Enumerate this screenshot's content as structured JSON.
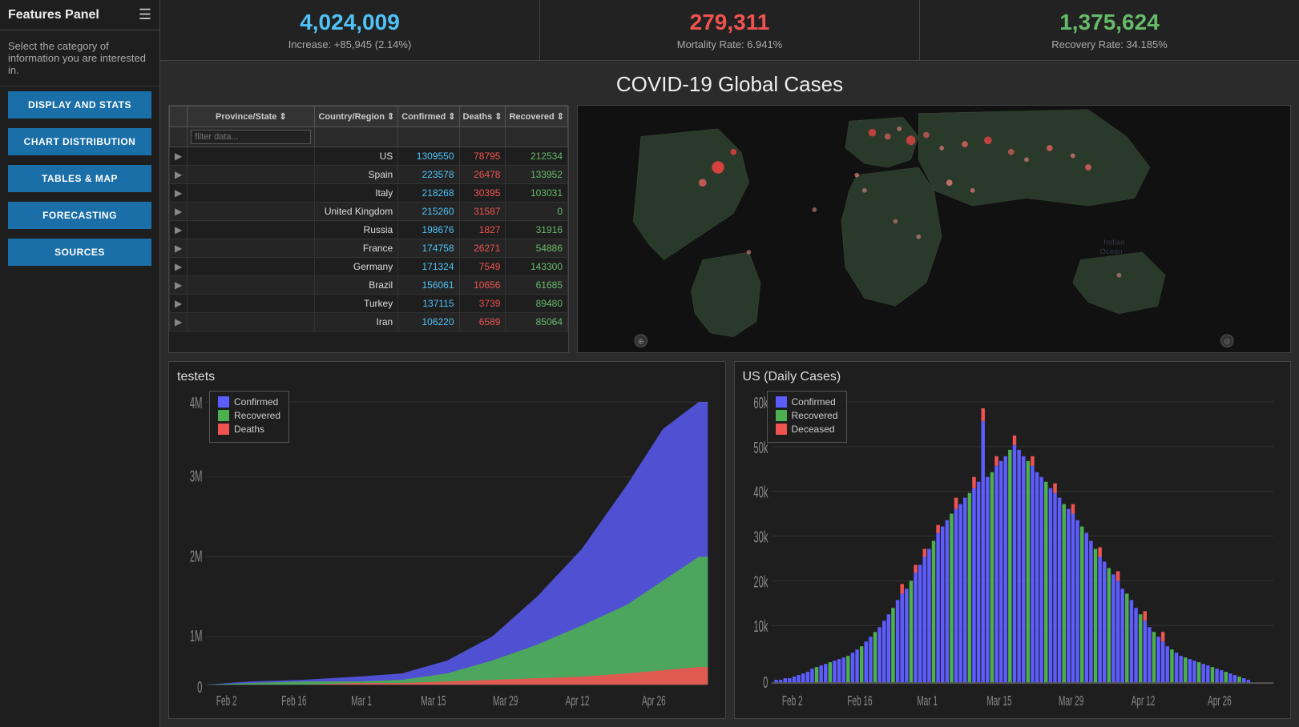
{
  "sidebar": {
    "title": "Features Panel",
    "hamburger": "☰",
    "description": "Select the category of information you are interested in.",
    "buttons": [
      {
        "label": "DISPLAY AND STATS",
        "id": "btn-display"
      },
      {
        "label": "CHART DISTRIBUTION",
        "id": "btn-chart"
      },
      {
        "label": "TABLES & MAP",
        "id": "btn-tables"
      },
      {
        "label": "FORECASTING",
        "id": "btn-forecasting"
      },
      {
        "label": "SOURCES",
        "id": "btn-sources"
      }
    ]
  },
  "stats": [
    {
      "number": "4,024,009",
      "class": "blue",
      "sub": "Increase: +85,945 (2.14%)"
    },
    {
      "number": "279,311",
      "class": "red",
      "sub": "Mortality Rate: 6.941%"
    },
    {
      "number": "1,375,624",
      "class": "green",
      "sub": "Recovery Rate: 34.185%"
    }
  ],
  "section_title": "COVID-19 Global Cases",
  "table": {
    "headers": [
      "",
      "Province/State",
      "Country/Region",
      "Confirmed",
      "Deaths",
      "Recovered"
    ],
    "filter_placeholder": "filter data...",
    "rows": [
      {
        "arrow": "▶",
        "province": "",
        "country": "US",
        "confirmed": "1309550",
        "deaths": "78795",
        "recovered": "212534"
      },
      {
        "arrow": "▶",
        "province": "",
        "country": "Spain",
        "confirmed": "223578",
        "deaths": "26478",
        "recovered": "133952"
      },
      {
        "arrow": "▶",
        "province": "",
        "country": "Italy",
        "confirmed": "218268",
        "deaths": "30395",
        "recovered": "103031"
      },
      {
        "arrow": "▶",
        "province": "",
        "country": "United Kingdom",
        "confirmed": "215260",
        "deaths": "31587",
        "recovered": "0"
      },
      {
        "arrow": "▶",
        "province": "",
        "country": "Russia",
        "confirmed": "198676",
        "deaths": "1827",
        "recovered": "31916"
      },
      {
        "arrow": "▶",
        "province": "",
        "country": "France",
        "confirmed": "174758",
        "deaths": "26271",
        "recovered": "54886"
      },
      {
        "arrow": "▶",
        "province": "",
        "country": "Germany",
        "confirmed": "171324",
        "deaths": "7549",
        "recovered": "143300"
      },
      {
        "arrow": "▶",
        "province": "",
        "country": "Brazil",
        "confirmed": "156061",
        "deaths": "10656",
        "recovered": "61685"
      },
      {
        "arrow": "▶",
        "province": "",
        "country": "Turkey",
        "confirmed": "137115",
        "deaths": "3739",
        "recovered": "89480"
      },
      {
        "arrow": "▶",
        "province": "",
        "country": "Iran",
        "confirmed": "106220",
        "deaths": "6589",
        "recovered": "85064"
      }
    ]
  },
  "chart_left": {
    "title": "testets",
    "legend": [
      {
        "label": "Confirmed",
        "color": "#5c5cff"
      },
      {
        "label": "Recovered",
        "color": "#4caf50"
      },
      {
        "label": "Deaths",
        "color": "#ef5350"
      }
    ],
    "x_labels": [
      "Feb 2",
      "Feb 16",
      "Mar 1",
      "Mar 15",
      "Mar 29",
      "Apr 12",
      "Apr 26"
    ],
    "y_labels": [
      "4M",
      "3M",
      "2M",
      "1M",
      "0"
    ]
  },
  "chart_right": {
    "title": "US (Daily Cases)",
    "legend": [
      {
        "label": "Confirmed",
        "color": "#5c5cff"
      },
      {
        "label": "Recovered",
        "color": "#4caf50"
      },
      {
        "label": "Deceased",
        "color": "#ef5350"
      }
    ],
    "x_labels": [
      "Feb 2",
      "Feb 16",
      "Mar 1",
      "Mar 15",
      "Mar 29",
      "Apr 12",
      "Apr 26"
    ],
    "y_labels": [
      "60k",
      "50k",
      "40k",
      "30k",
      "20k",
      "10k",
      "0"
    ]
  },
  "colors": {
    "confirmed": "#4fc3f7",
    "deaths": "#ef5350",
    "recovered": "#66bb6a",
    "sidebar_bg": "#1e1e1e",
    "main_bg": "#2b2b2b",
    "button_bg": "#1a6fa8"
  }
}
